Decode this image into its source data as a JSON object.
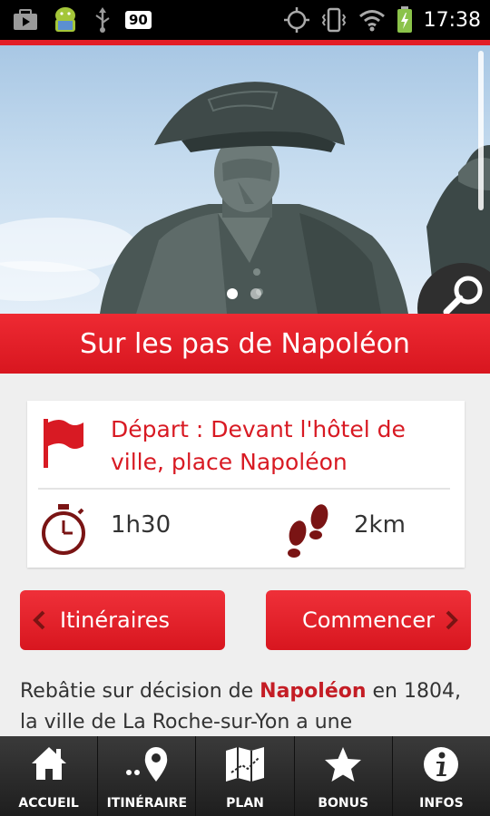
{
  "status_bar": {
    "battery_level_badge": "90",
    "time": "17:38"
  },
  "hero": {
    "carousel_total": 2,
    "carousel_active": 1
  },
  "tour": {
    "title": "Sur les pas de Napoléon",
    "depart": "Départ : Devant l'hôtel de ville, place Napoléon",
    "duration": "1h30",
    "distance": "2km"
  },
  "actions": {
    "itineraires_label": "Itinéraires",
    "commencer_label": "Commencer"
  },
  "description": {
    "part1": "Rebâtie sur décision de ",
    "highlight": "Napoléon",
    "part2": " en 1804, la ville de La Roche-sur-Yon a une"
  },
  "bottom_nav": [
    {
      "label": "ACCUEIL",
      "icon": "home-icon"
    },
    {
      "label": "ITINÉRAIRE",
      "icon": "route-pin-icon"
    },
    {
      "label": "PLAN",
      "icon": "map-icon"
    },
    {
      "label": "BONUS",
      "icon": "star-icon"
    },
    {
      "label": "INFOS",
      "icon": "info-icon"
    }
  ],
  "colors": {
    "accent_red": "#e21e26",
    "dark_red": "#8a1a1a",
    "nav_background": "#2a2a2a"
  }
}
